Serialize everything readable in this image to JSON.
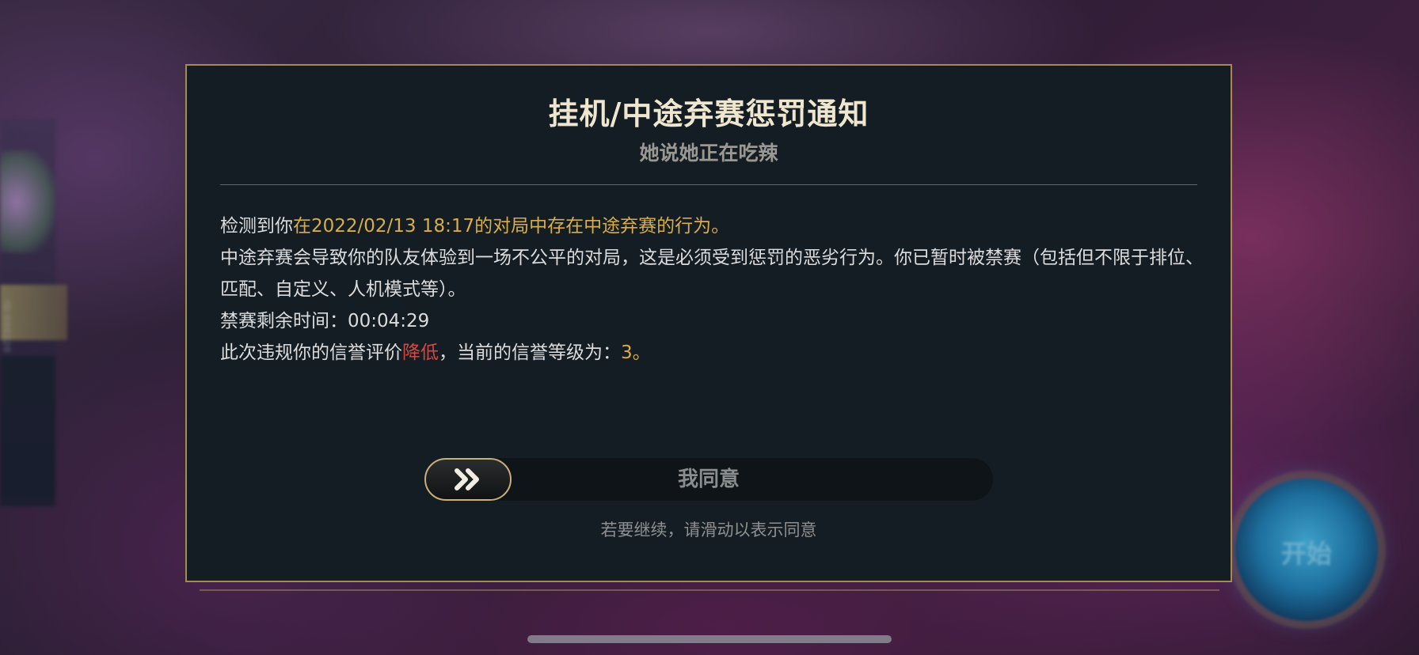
{
  "background": {
    "side_text": "ID:000220",
    "orb_label": "开始"
  },
  "dialog": {
    "title": "挂机/中途弃赛惩罚通知",
    "subtitle": "她说她正在吃辣",
    "line1_prefix": "检测到你",
    "line1_highlight": "在2022/02/13 18:17的对局中存在中途弃赛的行为。",
    "line2": "中途弃赛会导致你的队友体验到一场不公平的对局，这是必须受到惩罚的恶劣行为。你已暂时被禁赛（包括但不限于排位、匹配、自定义、人机模式等）。",
    "line3": "禁赛剩余时间：00:04:29",
    "line4_prefix": "此次违规你的信誉评价",
    "line4_decrease": "降低",
    "line4_mid": "，当前的信誉等级为：",
    "line4_level": "3。",
    "slider_label": "我同意",
    "hint": "若要继续，请滑动以表示同意"
  },
  "colors": {
    "gold_highlight": "#d8ad4a",
    "red_highlight": "#d04a43",
    "border_gold": "#a38b52"
  },
  "icons": {
    "slider_handle": "double-chevron-right-icon"
  }
}
